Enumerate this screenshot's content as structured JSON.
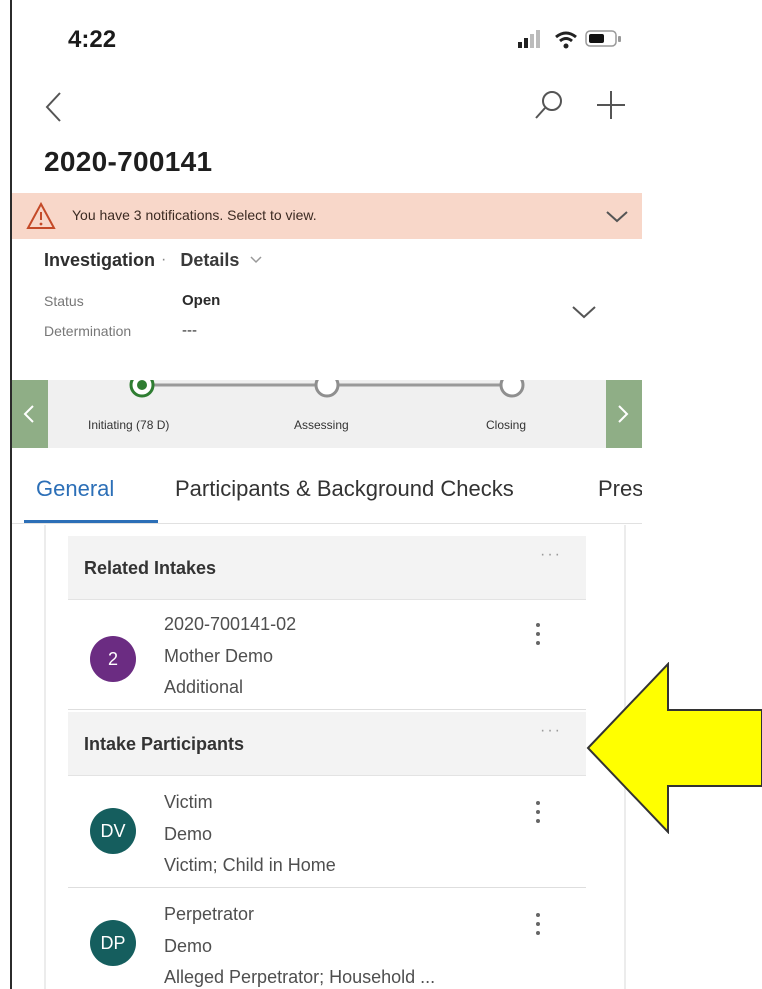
{
  "status_bar": {
    "time": "4:22"
  },
  "header": {
    "record_title": "2020-700141"
  },
  "notification": {
    "text": "You have 3 notifications. Select to view."
  },
  "form_selector": {
    "entity": "Investigation",
    "separator": "·",
    "form_name": "Details"
  },
  "header_fields": [
    {
      "label": "Status",
      "value": "Open"
    },
    {
      "label": "Determination",
      "value": "---"
    }
  ],
  "process_flow": {
    "stages": [
      {
        "label": "Initiating  (78 D)",
        "state": "active"
      },
      {
        "label": "Assessing",
        "state": "pending"
      },
      {
        "label": "Closing",
        "state": "pending"
      }
    ]
  },
  "tabs": [
    {
      "label": "General",
      "active": true
    },
    {
      "label": "Participants & Background Checks",
      "active": false
    },
    {
      "label": "Pres",
      "active": false
    }
  ],
  "related_intakes": {
    "title": "Related Intakes",
    "more": "···",
    "items": [
      {
        "initials": "2",
        "avatar_color": "#6b2c82",
        "line1": "2020-700141-02",
        "line2": "Mother Demo",
        "line3": "Additional"
      }
    ]
  },
  "intake_participants": {
    "title": "Intake Participants",
    "more": "···",
    "items": [
      {
        "initials": "DV",
        "avatar_color": "#155e5e",
        "line1": "Victim",
        "line2": "Demo",
        "line3": "Victim; Child in Home"
      },
      {
        "initials": "DP",
        "avatar_color": "#155e5e",
        "line1": "Perpetrator",
        "line2": "Demo",
        "line3": "Alleged Perpetrator; Household ..."
      }
    ]
  },
  "colors": {
    "accent_blue": "#2c6fb7",
    "notification_bg": "#f8d7c9",
    "stage_active": "#2f7d32",
    "bpf_nav": "#8fae86",
    "callout_arrow": "#ffff00"
  },
  "icons": [
    "back-arrow-icon",
    "search-icon",
    "plus-icon",
    "warning-icon",
    "chevron-down-icon",
    "chevron-left-icon",
    "chevron-right-icon",
    "more-vertical-icon",
    "more-horizontal-icon"
  ]
}
